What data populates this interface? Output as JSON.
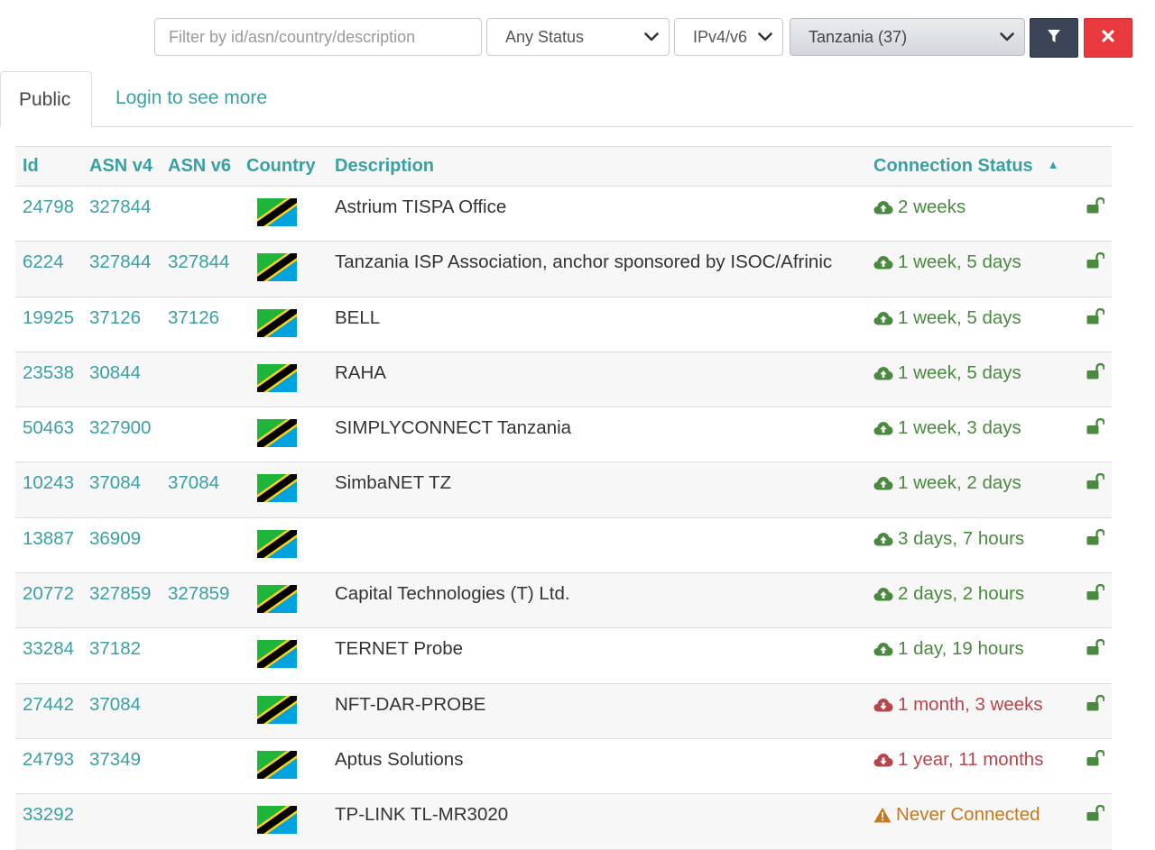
{
  "filter": {
    "placeholder": "Filter by id/asn/country/description",
    "status_value": "Any Status",
    "ip_value": "IPv4/v6",
    "country_value": "Tanzania (37)",
    "filter_icon": "funnel-icon",
    "clear_icon": "close-icon"
  },
  "tabs": {
    "public": "Public",
    "login": "Login to see more"
  },
  "table": {
    "headers": {
      "id": "Id",
      "asn_v4": "ASN v4",
      "asn_v6": "ASN v6",
      "country": "Country",
      "description": "Description",
      "status": "Connection Status"
    },
    "sort_column": "Connection Status",
    "sort_direction": "ascending",
    "rows": [
      {
        "id": "24798",
        "asn_v4": "327844",
        "asn_v6": "",
        "description": "Astrium TISPA Office",
        "status": "2 weeks",
        "state": "connected"
      },
      {
        "id": "6224",
        "asn_v4": "327844",
        "asn_v6": "327844",
        "description": "Tanzania ISP Association, anchor sponsored by ISOC/Afrinic",
        "status": "1 week, 5 days",
        "state": "connected"
      },
      {
        "id": "19925",
        "asn_v4": "37126",
        "asn_v6": "37126",
        "description": "BELL",
        "status": "1 week, 5 days",
        "state": "connected"
      },
      {
        "id": "23538",
        "asn_v4": "30844",
        "asn_v6": "",
        "description": "RAHA",
        "status": "1 week, 5 days",
        "state": "connected"
      },
      {
        "id": "50463",
        "asn_v4": "327900",
        "asn_v6": "",
        "description": "SIMPLYCONNECT Tanzania",
        "status": "1 week, 3 days",
        "state": "connected"
      },
      {
        "id": "10243",
        "asn_v4": "37084",
        "asn_v6": "37084",
        "description": "SimbaNET TZ",
        "status": "1 week, 2 days",
        "state": "connected"
      },
      {
        "id": "13887",
        "asn_v4": "36909",
        "asn_v6": "",
        "description": "",
        "status": "3 days, 7 hours",
        "state": "connected"
      },
      {
        "id": "20772",
        "asn_v4": "327859",
        "asn_v6": "327859",
        "description": "Capital Technologies (T) Ltd.",
        "status": "2 days, 2 hours",
        "state": "connected"
      },
      {
        "id": "33284",
        "asn_v4": "37182",
        "asn_v6": "",
        "description": "TERNET Probe",
        "status": "1 day, 19 hours",
        "state": "connected"
      },
      {
        "id": "27442",
        "asn_v4": "37084",
        "asn_v6": "",
        "description": "NFT-DAR-PROBE",
        "status": "1 month, 3 weeks",
        "state": "disconnected"
      },
      {
        "id": "24793",
        "asn_v4": "37349",
        "asn_v6": "",
        "description": "Aptus Solutions",
        "status": "1 year, 11 months",
        "state": "disconnected"
      },
      {
        "id": "33292",
        "asn_v4": "",
        "asn_v6": "",
        "description": "TP-LINK TL-MR3020",
        "status": "Never Connected",
        "state": "never"
      }
    ]
  },
  "colors": {
    "link": "#3aa0a4",
    "connected": "#4a8a3f",
    "disconnected": "#b8454a",
    "never": "#c7781a",
    "filter_button": "#3b4557",
    "clear_button": "#e8393f",
    "lock": "#4a8a3f"
  },
  "icons": {
    "connected": "cloud-upload-icon",
    "disconnected": "cloud-download-icon",
    "never": "warning-icon",
    "row_lock": "unlock-icon",
    "country_flag": "tanzania-flag-icon"
  }
}
